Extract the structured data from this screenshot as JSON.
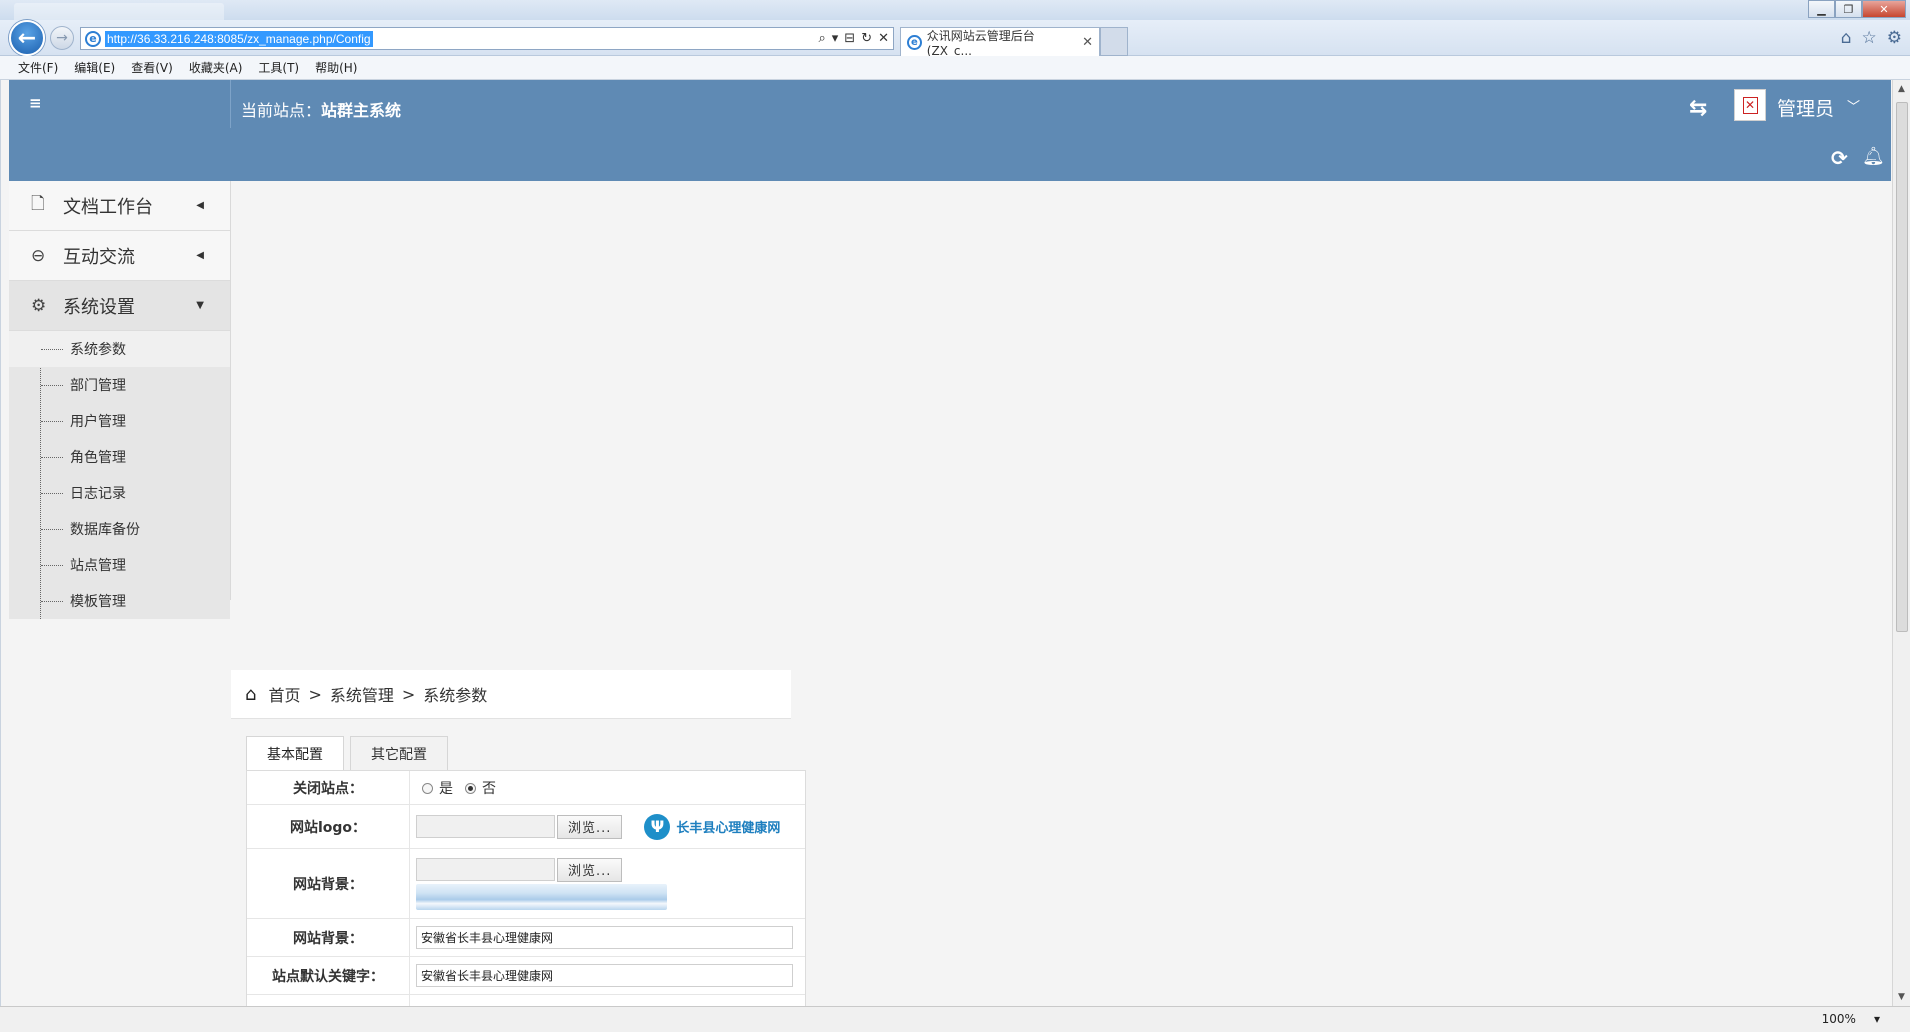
{
  "browser": {
    "url": "http://36.33.216.248:8085/zx_manage.php/Config",
    "tab_title": "众讯网站云管理后台(ZX_c...",
    "menu": [
      "文件(F)",
      "编辑(E)",
      "查看(V)",
      "收藏夹(A)",
      "工具(T)",
      "帮助(H)"
    ],
    "zoom": "100%"
  },
  "header": {
    "current_site_label": "当前站点：",
    "current_site_name": "站群主系统",
    "admin_label": "管理员"
  },
  "sidebar": {
    "items": [
      {
        "label": "文档工作台"
      },
      {
        "label": "互动交流"
      },
      {
        "label": "系统设置"
      }
    ],
    "submenu": [
      "系统参数",
      "部门管理",
      "用户管理",
      "角色管理",
      "日志记录",
      "数据库备份",
      "站点管理",
      "模板管理"
    ]
  },
  "breadcrumb": {
    "home": "首页",
    "level1": "系统管理",
    "level2": "系统参数",
    "sep": ">"
  },
  "tabs": [
    "基本配置",
    "其它配置"
  ],
  "form": {
    "close_site": {
      "label": "关闭站点：",
      "opt_yes": "是",
      "opt_no": "否",
      "selected": "否"
    },
    "logo": {
      "label": "网站logo：",
      "browse": "浏览...",
      "logo_text": "长丰县心理健康网"
    },
    "background": {
      "label": "网站背景：",
      "browse": "浏览..."
    },
    "background_text": {
      "label": "网站背景：",
      "value": "安徽省长丰县心理健康网"
    },
    "keywords": {
      "label": "站点默认关键字：",
      "value": "安徽省长丰县心理健康网"
    }
  },
  "colors": {
    "header": "#5f8ab4",
    "sidebar": "#f2f2f2",
    "submenu": "#e6e6e6"
  }
}
